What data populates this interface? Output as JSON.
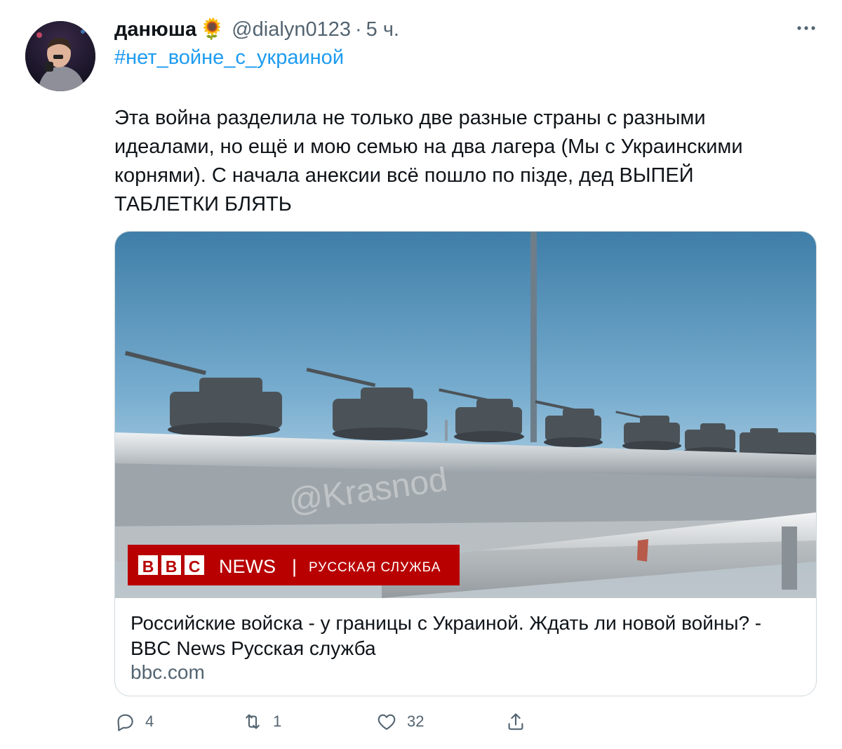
{
  "tweet": {
    "author": {
      "display_name": "данюша",
      "emoji": "🌻",
      "handle": "@dialyn0123",
      "separator": "·",
      "time": "5 ч."
    },
    "hashtag": "#нет_войне_с_украиной",
    "text": "Эта война разделила не только две разные страны с разными\nидеалами, но ещё и мою семью на два лагера (Мы с Украинскими\nкорнями). С начала анексии всё пошло по пізде, дед ВЫПЕЙ\nТАБЛЕТКИ БЛЯТЬ"
  },
  "card": {
    "image": {
      "banner": {
        "logo_letters": [
          "B",
          "B",
          "C"
        ],
        "news": "NEWS",
        "divider": "|",
        "service": "РУССКАЯ СЛУЖБА"
      },
      "watermark": "@Krasnod"
    },
    "title": "Российские войска - у границы с Украиной. Ждать ли новой войны? - BBC News Русская служба",
    "domain": "bbc.com"
  },
  "actions": {
    "replies": "4",
    "retweets": "1",
    "likes": "32"
  },
  "colors": {
    "link": "#1d9bf0",
    "secondary_text": "#536471",
    "border": "#cfd9de",
    "bbc_red": "#b80000"
  },
  "icons": [
    "more-icon",
    "reply-icon",
    "retweet-icon",
    "like-icon",
    "share-icon"
  ]
}
